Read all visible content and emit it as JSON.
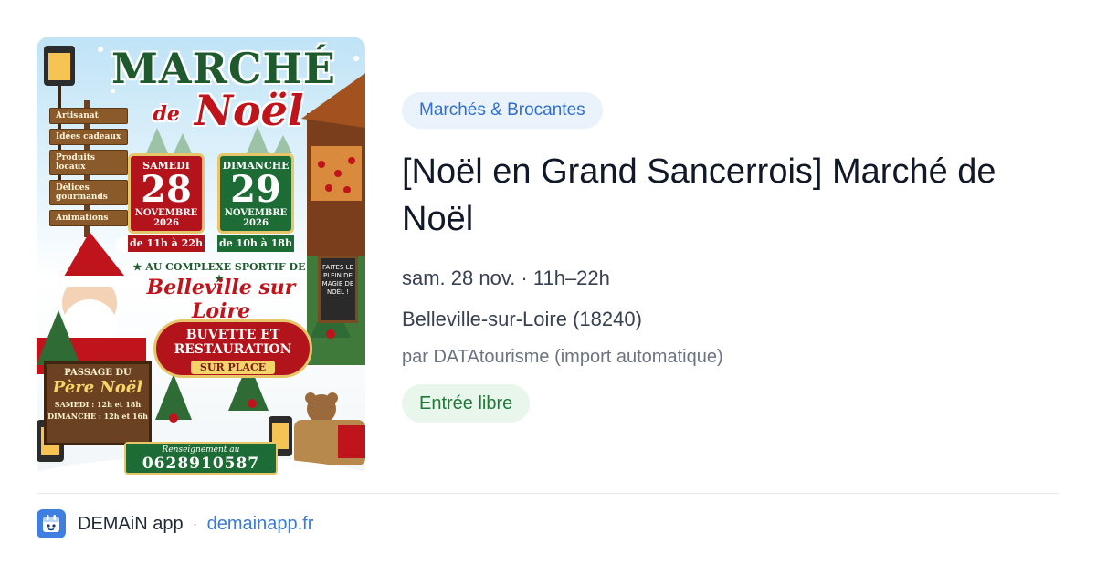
{
  "poster": {
    "title": "MARCHÉ",
    "subtitle_de": "de",
    "subtitle_noel": "Noël",
    "signs": [
      "Artisanat",
      "Idées cadeaux",
      "Produits locaux",
      "Délices gourmands",
      "Animations"
    ],
    "day1": {
      "day": "SAMEDI",
      "num": "28",
      "month": "NOVEMBRE",
      "year": "2026",
      "hours": "de 11h à 22h"
    },
    "day2": {
      "day": "DIMANCHE",
      "num": "29",
      "month": "NOVEMBRE",
      "year": "2026",
      "hours": "de 10h à 18h"
    },
    "venue_prefix": "★ AU COMPLEXE SPORTIF DE ★",
    "venue_name": "Belleville sur Loire",
    "buvette_1": "BUVETTE ET",
    "buvette_2": "RESTAURATION",
    "buvette_3": "SUR PLACE",
    "chalkboard": "FAITES LE PLEIN DE MAGIE DE NOËL !",
    "pere_1": "PASSAGE DU",
    "pere_2": "Père Noël",
    "pere_3": "SAMEDI : 12h et 18h",
    "pere_4": "DIMANCHE : 12h et 16h",
    "renseign_label": "Renseignement au",
    "renseign_phone": "0628910587"
  },
  "event": {
    "category": "Marchés & Brocantes",
    "title": "[Noël en Grand Sancerrois] Marché de Noël",
    "date": "sam. 28 nov. · 11h–22h",
    "place": "Belleville-sur-Loire (18240)",
    "source": "par DATAtourisme (import automatique)",
    "price": "Entrée libre"
  },
  "footer": {
    "app_name": "DEMAiN app",
    "separator": "·",
    "link": "demainapp.fr"
  },
  "colors": {
    "accent_blue": "#3a7bd5",
    "chip_bg": "#eaf2fc",
    "entry_green": "#1f7a3a",
    "entry_bg": "#e9f6ec"
  }
}
